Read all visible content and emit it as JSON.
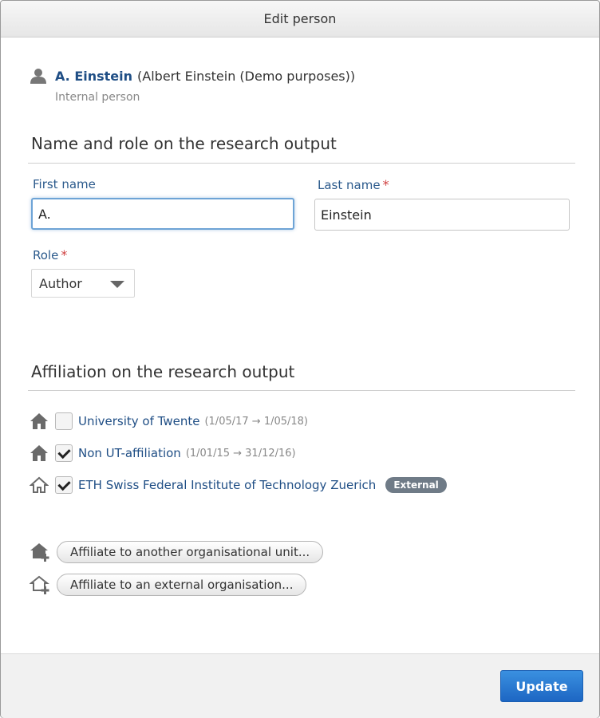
{
  "dialog": {
    "title": "Edit person"
  },
  "person": {
    "icon": "person-icon",
    "name_link": "A. Einstein",
    "full_name_paren": "(Albert Einstein (Demo purposes))",
    "type": "Internal person"
  },
  "name_role_section": {
    "title": "Name and role on the research output",
    "first_name": {
      "label": "First name",
      "value": "A.",
      "focused": true
    },
    "last_name": {
      "label": "Last name",
      "required_mark": "*",
      "value": "Einstein"
    },
    "role": {
      "label": "Role",
      "required_mark": "*",
      "selected": "Author"
    }
  },
  "affiliation_section": {
    "title": "Affiliation on the research output",
    "items": [
      {
        "icon": "house-filled-icon",
        "checked": false,
        "name": "University of Twente",
        "dates": "(1/05/17 → 1/05/18)",
        "badge": ""
      },
      {
        "icon": "house-filled-icon",
        "checked": true,
        "name": "Non UT-affiliation",
        "dates": "(1/01/15 → 31/12/16)",
        "badge": ""
      },
      {
        "icon": "house-outline-icon",
        "checked": true,
        "name": "ETH Swiss Federal Institute of Technology Zuerich",
        "dates": "",
        "badge": "External"
      }
    ],
    "actions": [
      {
        "icon": "house-add-icon",
        "label": "Affiliate to another organisational unit..."
      },
      {
        "icon": "house-outline-add-icon",
        "label": "Affiliate to an external organisation..."
      }
    ]
  },
  "footer": {
    "update_label": "Update"
  },
  "colors": {
    "link": "#1f4e85",
    "required": "#d04040",
    "primary_button": "#2a7bd6",
    "badge": "#6f7b87"
  }
}
